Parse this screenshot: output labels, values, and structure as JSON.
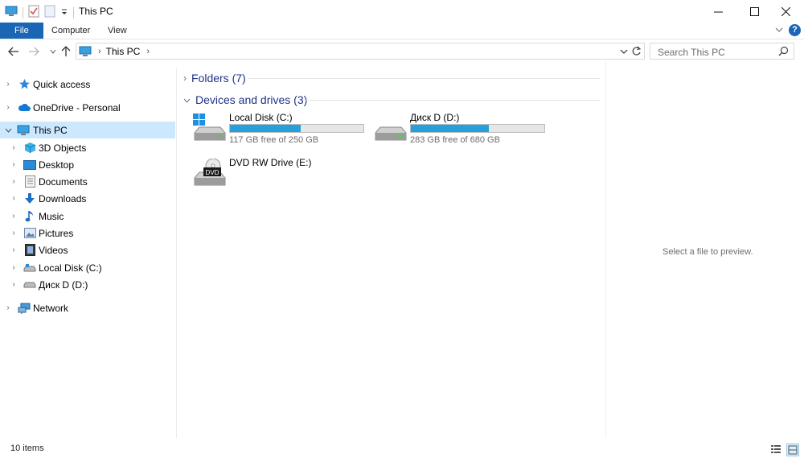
{
  "window": {
    "title": "This PC",
    "minimize_glyph": "—",
    "maximize_glyph": "☐",
    "close_glyph": "✕"
  },
  "ribbon": {
    "tabs": [
      "File",
      "Computer",
      "View"
    ],
    "help_label": "?"
  },
  "address_bar": {
    "crumb": "This PC"
  },
  "search": {
    "placeholder": "Search This PC"
  },
  "sidebar": {
    "items": [
      {
        "label": "Quick access",
        "icon": "star-icon"
      },
      {
        "label": "OneDrive - Personal",
        "icon": "cloud-icon"
      },
      {
        "label": "This PC",
        "icon": "monitor-icon",
        "selected": true
      },
      {
        "label": "3D Objects",
        "icon": "cube-icon"
      },
      {
        "label": "Desktop",
        "icon": "desktop-icon"
      },
      {
        "label": "Documents",
        "icon": "document-icon"
      },
      {
        "label": "Downloads",
        "icon": "download-icon"
      },
      {
        "label": "Music",
        "icon": "music-icon"
      },
      {
        "label": "Pictures",
        "icon": "picture-icon"
      },
      {
        "label": "Videos",
        "icon": "video-icon"
      },
      {
        "label": "Local Disk (C:)",
        "icon": "disk-icon"
      },
      {
        "label": "Диск D (D:)",
        "icon": "disk-icon"
      },
      {
        "label": "Network",
        "icon": "network-icon"
      }
    ]
  },
  "content": {
    "folders_header": "Folders (7)",
    "devices_header": "Devices and drives (3)",
    "drives": [
      {
        "name": "Local Disk (C:)",
        "free": "117 GB free of 250 GB",
        "used_fraction": 0.532,
        "icon": "windows-disk-icon"
      },
      {
        "name": "Диск D (D:)",
        "free": "283 GB free of 680 GB",
        "used_fraction": 0.584,
        "icon": "hard-disk-icon"
      },
      {
        "name": "DVD RW Drive (E:)",
        "icon": "dvd-drive-icon",
        "badge": "DVD"
      }
    ]
  },
  "preview": {
    "message": "Select a file to preview."
  },
  "status": {
    "item_count": "10 items"
  },
  "colors": {
    "accent": "#1a65b4",
    "selection": "#cce8ff",
    "progress": "#26a0da",
    "group_header": "#1e3287"
  }
}
